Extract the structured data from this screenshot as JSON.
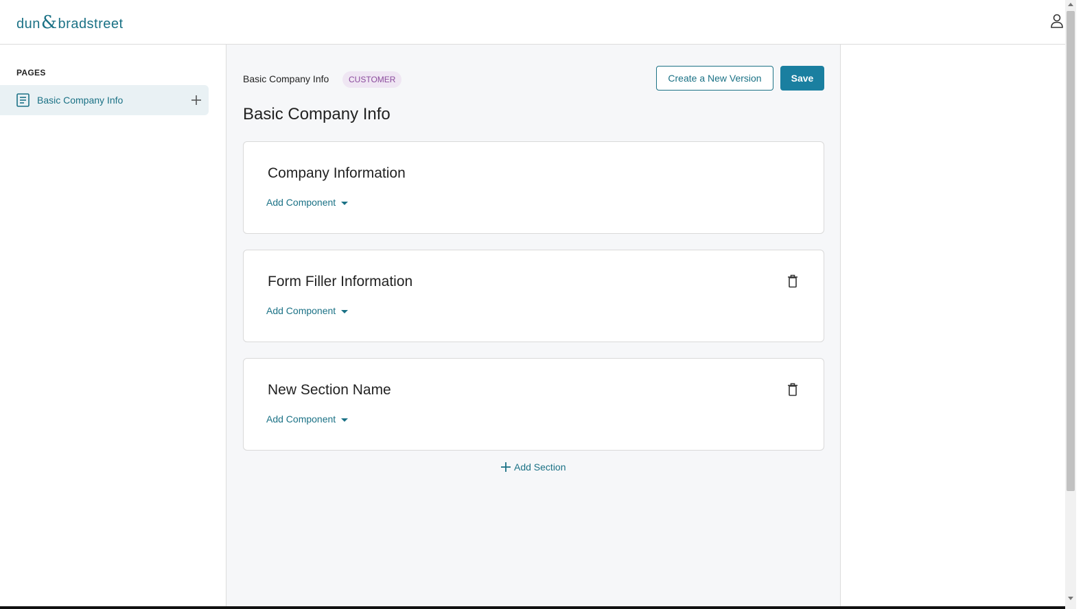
{
  "header": {
    "logo_left": "dun",
    "logo_amp": "&",
    "logo_right": "bradstreet",
    "user_icon": "user-icon"
  },
  "sidebar": {
    "heading": "PAGES",
    "items": [
      {
        "label": "Basic Company Info",
        "icon": "document-icon",
        "action_icon": "plus-icon"
      }
    ]
  },
  "main": {
    "breadcrumb": "Basic Company Info",
    "badge": "CUSTOMER",
    "create_version_label": "Create a New Version",
    "save_label": "Save",
    "page_title": "Basic Company Info",
    "sections": [
      {
        "title": "Company Information",
        "add_component_label": "Add Component",
        "deletable": false
      },
      {
        "title": "Form Filler Information",
        "add_component_label": "Add Component",
        "deletable": true
      },
      {
        "title": "New Section Name",
        "add_component_label": "Add Component",
        "deletable": true
      }
    ],
    "add_section_label": "Add Section"
  },
  "colors": {
    "accent": "#1a7185",
    "primary_button": "#1a7fa0",
    "badge_bg": "#efe6f3",
    "badge_text": "#8a4a9c",
    "selected_item_bg": "#e9f1f4"
  }
}
